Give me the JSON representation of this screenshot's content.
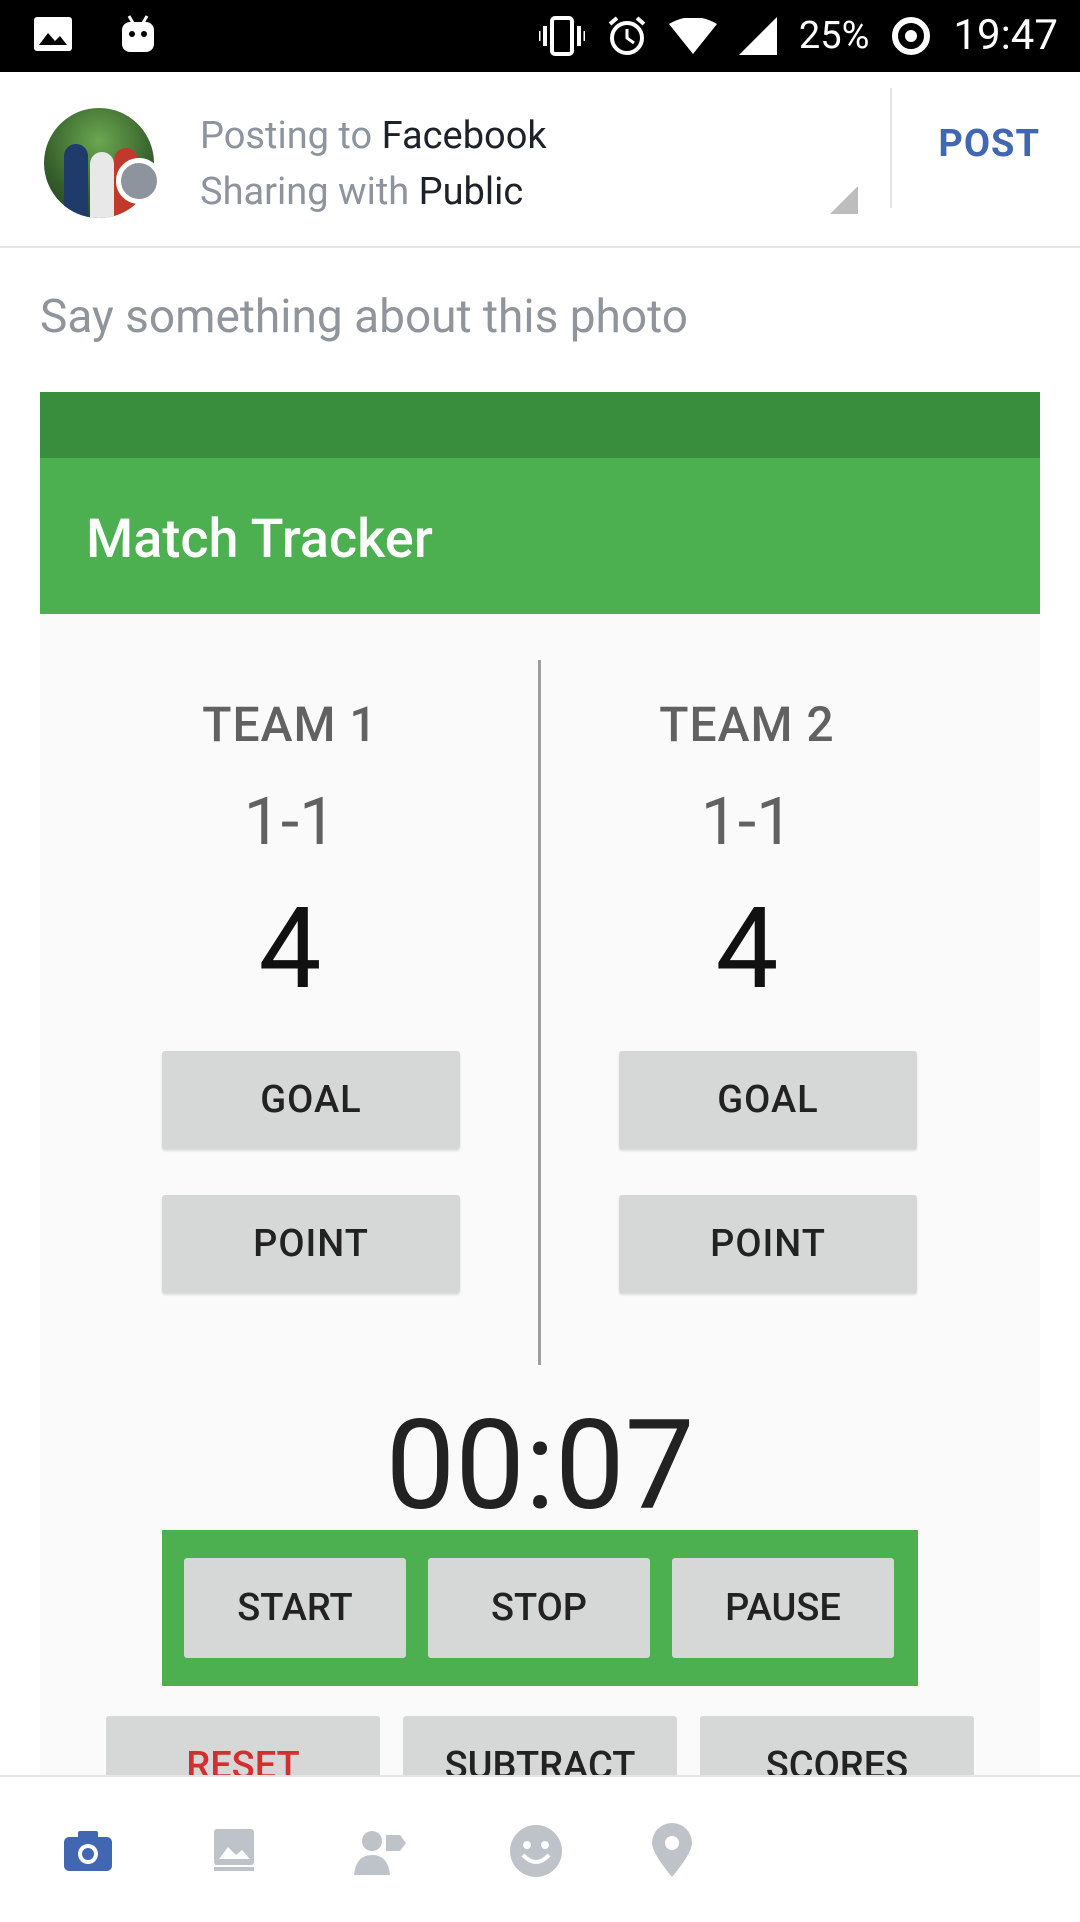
{
  "status_bar": {
    "battery": "25%",
    "time": "19:47",
    "icons": [
      "image-icon",
      "android-icon",
      "vibrate-icon",
      "alarm-icon",
      "wifi-icon",
      "signal-icon",
      "battery-saver-icon"
    ]
  },
  "composer": {
    "posting_prefix": "Posting to",
    "posting_target": "Facebook",
    "sharing_prefix": "Sharing with",
    "sharing_target": "Public",
    "post_label": "POST",
    "caption_placeholder": "Say something about this photo"
  },
  "app": {
    "title": "Match Tracker",
    "teams": [
      {
        "name": "TEAM 1",
        "score": "1-1",
        "total": "4",
        "goal_label": "GOAL",
        "point_label": "POINT"
      },
      {
        "name": "TEAM 2",
        "score": "1-1",
        "total": "4",
        "goal_label": "GOAL",
        "point_label": "POINT"
      }
    ],
    "timer": "00:07",
    "controls": {
      "start": "START",
      "stop": "STOP",
      "pause": "PAUSE"
    },
    "actions": {
      "reset": "RESET",
      "subtract": "SUBTRACT",
      "scores": "SCORES"
    },
    "colors": {
      "primary": "#4caf50",
      "primary_dark": "#388e3c",
      "reset": "#d32f2f"
    }
  },
  "toolbar": {
    "icons": [
      "camera-icon",
      "photo-album-icon",
      "tag-people-icon",
      "feeling-icon",
      "location-icon"
    ],
    "active_color": "#4267b2"
  }
}
